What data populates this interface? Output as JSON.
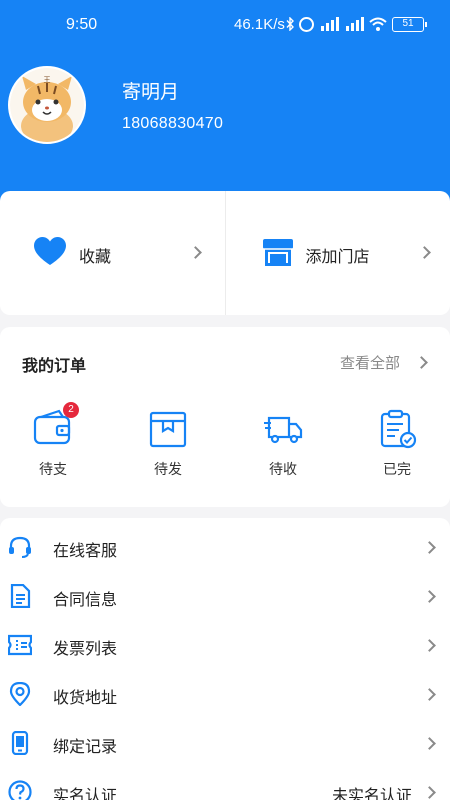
{
  "status_bar": {
    "time": "9:50",
    "network_speed": "46.1K/s",
    "battery": "51",
    "icons": [
      "bluetooth-icon",
      "alarm-icon",
      "hd-signal-icon",
      "hd-signal-icon",
      "wifi-icon",
      "battery-icon"
    ]
  },
  "profile": {
    "name": "寄明月",
    "phone": "18068830470"
  },
  "quick_links": {
    "favorites_label": "收藏",
    "add_store_label": "添加门店"
  },
  "orders": {
    "title": "我的订单",
    "view_all": "查看全部",
    "items": [
      {
        "label": "待支",
        "badge": "2",
        "icon": "wallet-icon"
      },
      {
        "label": "待发",
        "icon": "box-icon"
      },
      {
        "label": "待收",
        "icon": "truck-icon"
      },
      {
        "label": "已完",
        "icon": "clipboard-check-icon"
      }
    ]
  },
  "menu": {
    "items": [
      {
        "label": "在线客服",
        "icon": "headset-icon"
      },
      {
        "label": "合同信息",
        "icon": "document-icon"
      },
      {
        "label": "发票列表",
        "icon": "ticket-icon"
      },
      {
        "label": "收货地址",
        "icon": "location-pin-icon"
      },
      {
        "label": "绑定记录",
        "icon": "phone-icon"
      },
      {
        "label": "实名认证",
        "icon": "question-circle-icon",
        "value": "未实名认证"
      }
    ]
  },
  "colors": {
    "primary": "#1683f5",
    "badge": "#e5283c",
    "background": "#f4f4f6"
  }
}
